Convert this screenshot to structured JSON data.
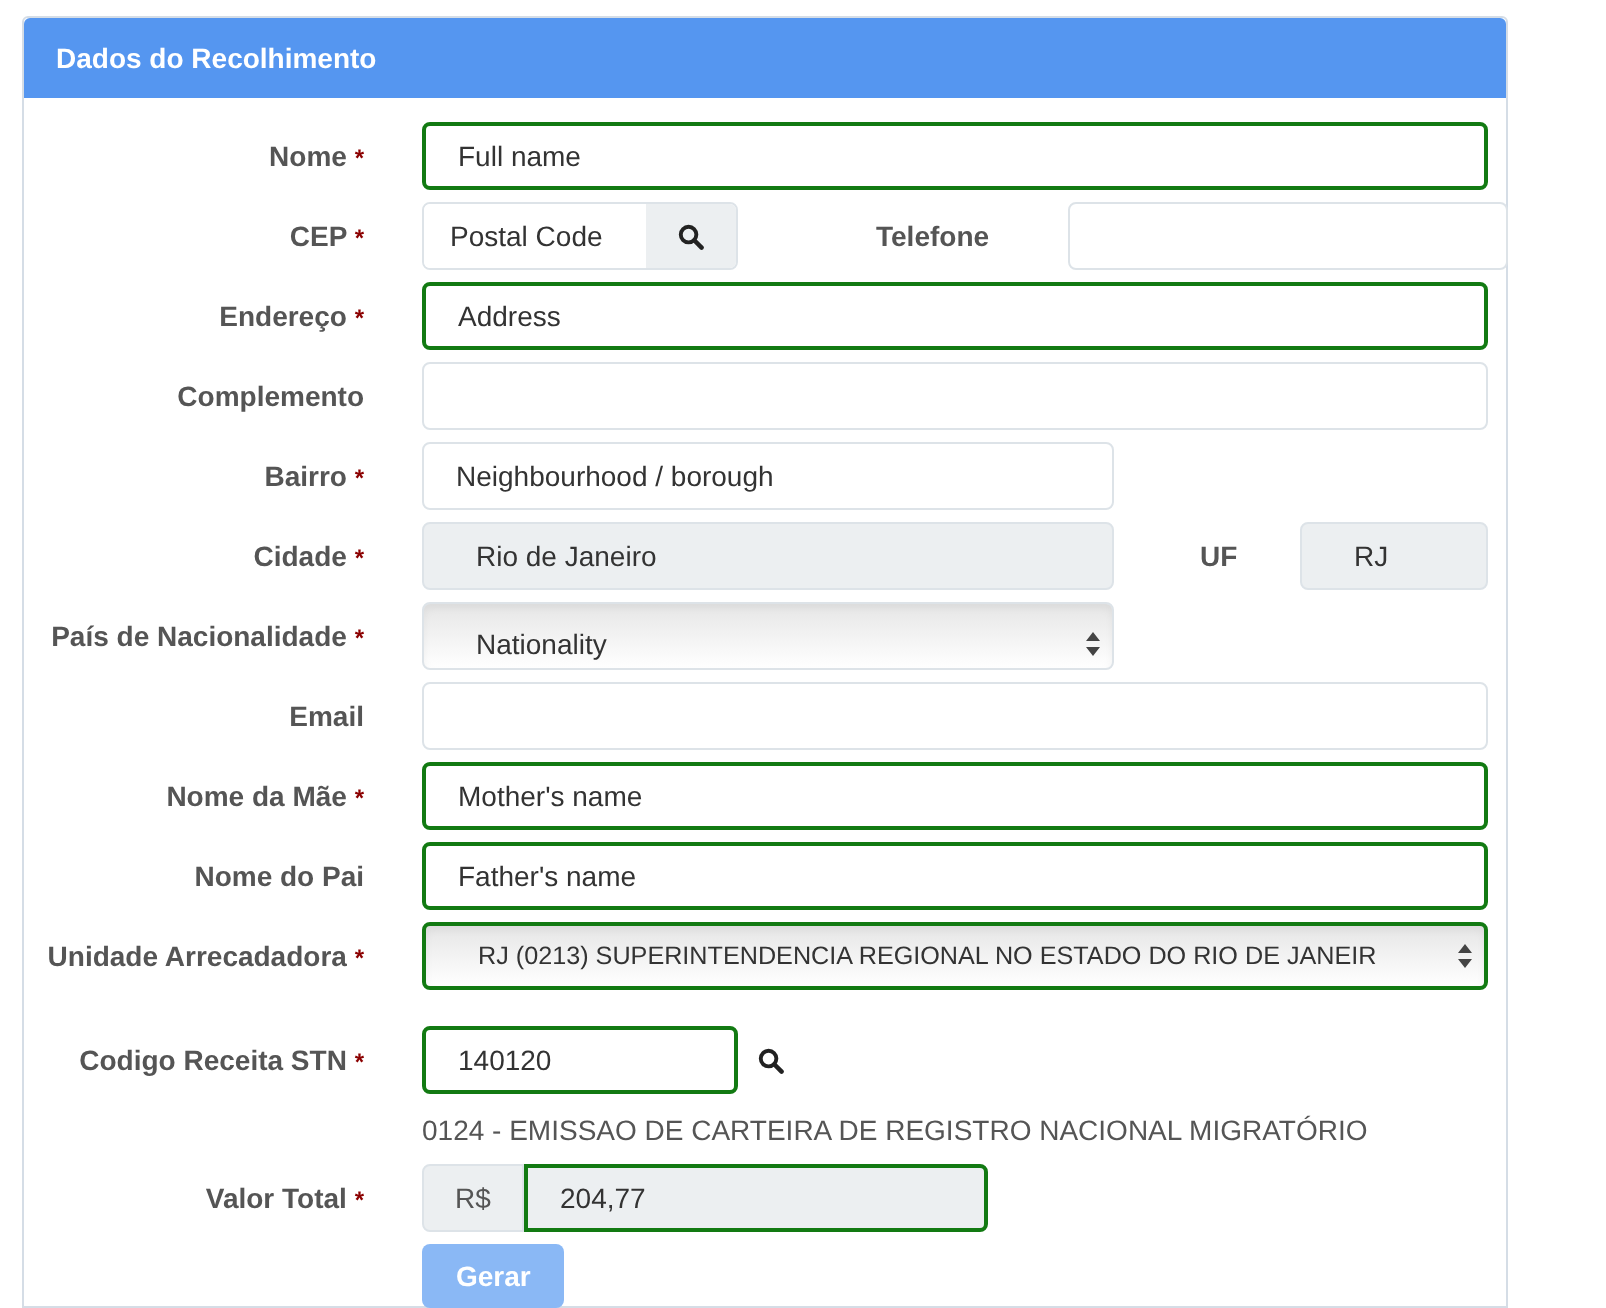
{
  "panel": {
    "title": "Dados do Recolhimento"
  },
  "rows": [
    {
      "kind": "full",
      "label": "Nome",
      "required_mark": "*",
      "field": {
        "value": "Full name",
        "valid": true
      }
    },
    {
      "kind": "cep",
      "label": "CEP",
      "required_mark": "*",
      "field": {
        "value": "Postal Code",
        "valid": false
      },
      "side_label": "Telefone",
      "side_field": {
        "valid": false
      }
    },
    {
      "kind": "full",
      "label": "Endereço",
      "required_mark": "*",
      "field": {
        "value": "Address",
        "valid": true
      }
    },
    {
      "kind": "full",
      "label": "Complemento",
      "field": {
        "valid": false
      }
    },
    {
      "kind": "half",
      "label": "Bairro",
      "required_mark": "*",
      "field": {
        "value": "Neighbourhood / borough",
        "valid": false
      }
    },
    {
      "kind": "city",
      "label": "Cidade",
      "required_mark": "*",
      "field": {
        "value": "Rio de Janeiro",
        "valid": false,
        "readonly": true
      },
      "side_label": "UF",
      "side_field": {
        "value": "RJ",
        "valid": false,
        "readonly": true
      }
    },
    {
      "kind": "select-half",
      "label": "País de Nacionalidade",
      "required_mark": "*",
      "field": {
        "value": "Nationality",
        "valid": false
      }
    },
    {
      "kind": "full",
      "label": "Email",
      "field": {
        "valid": false
      }
    },
    {
      "kind": "full",
      "label": "Nome da Mãe",
      "required_mark": "*",
      "field": {
        "value": "Mother's name",
        "valid": true
      }
    },
    {
      "kind": "full",
      "label": "Nome do Pai",
      "field": {
        "value": "Father's name",
        "valid": true
      }
    },
    {
      "kind": "select-full",
      "label": "Unidade Arrecadadora",
      "required_mark": "*",
      "field": {
        "value": "RJ (0213) SUPERINTENDENCIA REGIONAL NO ESTADO DO RIO DE JANEIR",
        "valid": true
      }
    },
    {
      "kind": "code",
      "label": "Codigo Receita STN",
      "required_mark": "*",
      "field": {
        "value": "140120",
        "valid": true
      },
      "note": "0124 - EMISSAO DE CARTEIRA DE REGISTRO NACIONAL MIGRATÓRIO"
    },
    {
      "kind": "money",
      "label": "Valor Total",
      "required_mark": "*",
      "prefix": "R$",
      "field": {
        "value": "204,77",
        "valid": true,
        "readonly": true
      }
    }
  ],
  "submit": {
    "label": "Gerar",
    "disabled": true
  }
}
